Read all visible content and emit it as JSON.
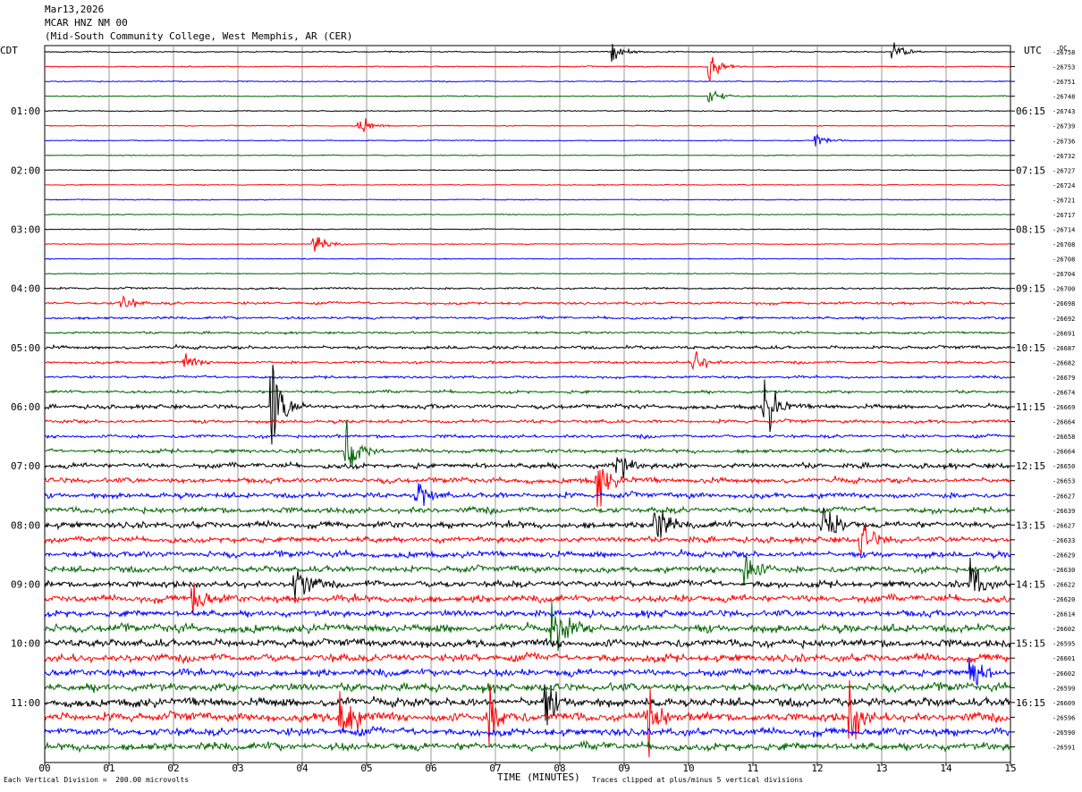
{
  "header": {
    "date": "Mar13,2026",
    "station": "MCAR HNZ NM 00",
    "location": "(Mid-South Community College, West Memphis, AR (CER)"
  },
  "left_tz": "CDT",
  "right_tz": "UTC",
  "dc_label": "DC",
  "footer": {
    "scale": "Each Vertical Division =  200.00 microvolts",
    "clip": "Traces clipped at plus/minus 5 vertical divisions",
    "xaxis_title": "TIME (MINUTES)"
  },
  "colors": {
    "trace_cycle": [
      "#000000",
      "#ff0000",
      "#0000ff",
      "#006400"
    ],
    "grid": "#808080"
  },
  "chart_data": {
    "type": "line",
    "xlabel": "TIME (MINUTES)",
    "xlim": [
      0,
      15
    ],
    "x_ticks": [
      "00",
      "01",
      "02",
      "03",
      "04",
      "05",
      "06",
      "07",
      "08",
      "09",
      "10",
      "11",
      "12",
      "13",
      "14",
      "15"
    ],
    "left_time_labels": [
      "01:00",
      "02:00",
      "03:00",
      "04:00",
      "05:00",
      "06:00",
      "07:00",
      "08:00",
      "09:00",
      "10:00",
      "11:00"
    ],
    "right_time_labels": [
      "06:15",
      "07:15",
      "08:15",
      "09:15",
      "10:15",
      "11:15",
      "12:15",
      "13:15",
      "14:15",
      "15:15",
      "16:15"
    ],
    "dc_offsets": [
      -26758,
      -26753,
      -26751,
      -26748,
      -26743,
      -26739,
      -26736,
      -26732,
      -26727,
      -26724,
      -26721,
      -26717,
      -26714,
      -26708,
      -26708,
      -26704,
      -26700,
      -26698,
      -26692,
      -26691,
      -26687,
      -26682,
      -26679,
      -26674,
      -26669,
      -26664,
      -26658,
      -26664,
      -26650,
      -26653,
      -26627,
      -26639,
      -26627,
      -26633,
      -26629,
      -26630,
      -26622,
      -26620,
      -26614,
      -26602,
      -26595,
      -26601,
      -26602,
      -26599,
      -26609,
      -26596,
      -26590,
      -26591
    ],
    "trace_activity": [
      0.35,
      0.35,
      0.35,
      0.35,
      0.35,
      0.3,
      0.3,
      0.3,
      0.3,
      0.3,
      0.3,
      0.3,
      0.3,
      0.3,
      0.3,
      0.3,
      0.6,
      0.8,
      0.8,
      0.7,
      1.0,
      0.8,
      0.8,
      0.9,
      1.3,
      1.0,
      1.0,
      1.2,
      1.6,
      1.6,
      1.6,
      1.8,
      2.0,
      1.8,
      1.8,
      1.9,
      2.0,
      2.2,
      2.0,
      2.4,
      2.4,
      2.4,
      2.2,
      2.4,
      2.6,
      2.6,
      2.4,
      2.4
    ],
    "spikes_total": 30,
    "events": [
      {
        "trace": 0,
        "minute": 8.85,
        "amp": 3
      },
      {
        "trace": 0,
        "minute": 13.2,
        "amp": 3.5
      },
      {
        "trace": 1,
        "minute": 10.35,
        "amp": 4
      },
      {
        "trace": 3,
        "minute": 10.35,
        "amp": 3
      },
      {
        "trace": 5,
        "minute": 4.9,
        "amp": 3
      },
      {
        "trace": 6,
        "minute": 12.0,
        "amp": 2
      },
      {
        "trace": 13,
        "minute": 4.2,
        "amp": 3
      },
      {
        "trace": 17,
        "minute": 1.2,
        "amp": 3
      },
      {
        "trace": 21,
        "minute": 2.2,
        "amp": 2.5
      },
      {
        "trace": 21,
        "minute": 10.1,
        "amp": 4
      },
      {
        "trace": 24,
        "minute": 3.55,
        "amp": 14
      },
      {
        "trace": 24,
        "minute": 11.2,
        "amp": 10
      },
      {
        "trace": 27,
        "minute": 4.7,
        "amp": 9
      },
      {
        "trace": 28,
        "minute": 8.9,
        "amp": 6
      },
      {
        "trace": 29,
        "minute": 8.6,
        "amp": 8
      },
      {
        "trace": 30,
        "minute": 5.8,
        "amp": 4
      },
      {
        "trace": 32,
        "minute": 9.5,
        "amp": 7
      },
      {
        "trace": 32,
        "minute": 12.1,
        "amp": 7
      },
      {
        "trace": 33,
        "minute": 12.7,
        "amp": 5
      },
      {
        "trace": 35,
        "minute": 10.9,
        "amp": 6
      },
      {
        "trace": 36,
        "minute": 3.9,
        "amp": 8
      },
      {
        "trace": 36,
        "minute": 14.4,
        "amp": 8
      },
      {
        "trace": 37,
        "minute": 2.3,
        "amp": 6
      },
      {
        "trace": 39,
        "minute": 7.9,
        "amp": 10
      },
      {
        "trace": 42,
        "minute": 14.4,
        "amp": 6
      },
      {
        "trace": 44,
        "minute": 7.8,
        "amp": 6
      },
      {
        "trace": 45,
        "minute": 4.6,
        "amp": 12
      },
      {
        "trace": 45,
        "minute": 9.35,
        "amp": 12
      },
      {
        "trace": 45,
        "minute": 12.5,
        "amp": 10
      },
      {
        "trace": 45,
        "minute": 6.9,
        "amp": 8
      }
    ]
  }
}
